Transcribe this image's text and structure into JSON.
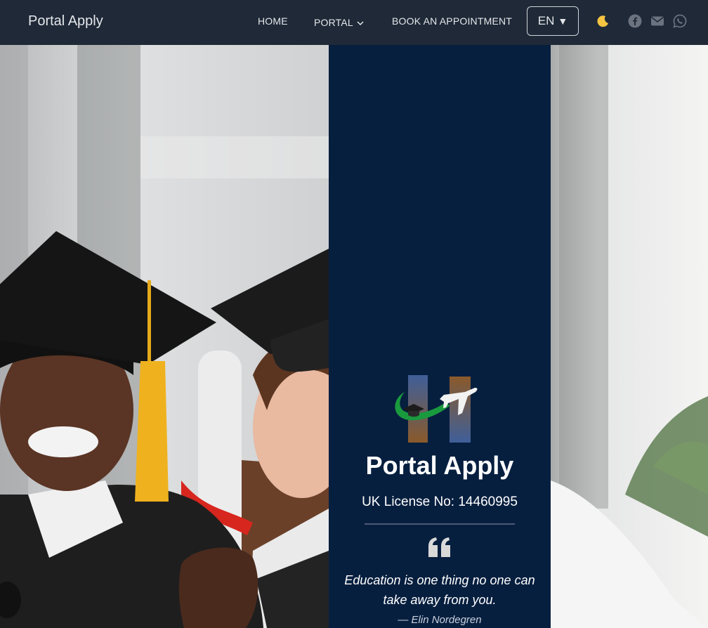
{
  "navbar": {
    "brand": "Portal Apply",
    "links": {
      "home": "HOME",
      "portal": "PORTAL",
      "book": "BOOK AN APPOINTMENT"
    },
    "language": {
      "label": "EN",
      "caret": "▼"
    },
    "icons": {
      "theme": "moon-icon",
      "facebook": "facebook-icon",
      "email": "envelope-icon",
      "whatsapp": "whatsapp-icon"
    }
  },
  "hero": {
    "title": "Portal Apply",
    "license": "UK License No: 14460995",
    "quote": "Education is one thing no one can take away from you.",
    "author": "— Elin Nordegren",
    "background": "graduates-photo",
    "colors": {
      "panel": "#071f3f",
      "navbar": "#1f2937"
    }
  }
}
